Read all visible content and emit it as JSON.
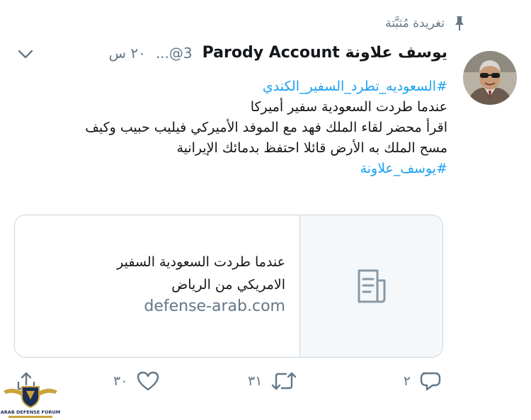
{
  "pinned": {
    "label": "تغريدة مُثبَّتة",
    "icon": "pin-icon"
  },
  "tweet": {
    "display_name": "يوسف علاونة Parody Account",
    "handle": "...@3",
    "time": "٢٠ س",
    "lines": [
      {
        "text": "#السعوديه_تطرد_السفير_الكندي",
        "hashtag": true
      },
      {
        "text": "عندما طردت السعودية سفير أميركا",
        "hashtag": false
      },
      {
        "text": "اقرأ محضر لقاء الملك فهد مع الموفد الأميركي فيليب حبيب وكيف",
        "hashtag": false
      },
      {
        "text": "مسح الملك به الأرض قائلا احتفظ بدمائك الإيرانية",
        "hashtag": false
      },
      {
        "text": "#يوسف_علاونة",
        "hashtag": true
      }
    ]
  },
  "card": {
    "title_line1": "عندما طردت السعودية السفير",
    "title_line2": "الامريكي من الرياض",
    "domain": "defense-arab.com",
    "icon": "document-icon"
  },
  "actions": {
    "reply_count": "٢",
    "retweet_count": "٣١",
    "like_count": "٣٠"
  },
  "watermark": {
    "text": "ARAB DEFENSE FORUM"
  },
  "colors": {
    "accent": "#1da1f2",
    "secondary_text": "#657786",
    "border": "#ccd6dd"
  }
}
